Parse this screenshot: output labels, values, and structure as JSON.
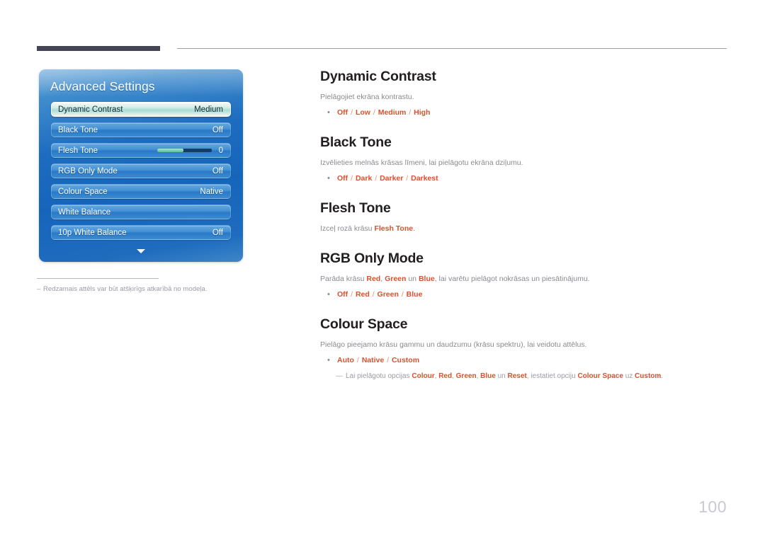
{
  "page": {
    "number": "100"
  },
  "osd": {
    "title": "Advanced Settings",
    "more_icon": "chevron-down-icon",
    "rows": [
      {
        "label": "Dynamic Contrast",
        "value": "Medium",
        "selected": true,
        "type": "value"
      },
      {
        "label": "Black Tone",
        "value": "Off",
        "selected": false,
        "type": "value"
      },
      {
        "label": "Flesh Tone",
        "value": "0",
        "selected": false,
        "type": "slider",
        "slider_percent": 48
      },
      {
        "label": "RGB Only Mode",
        "value": "Off",
        "selected": false,
        "type": "value"
      },
      {
        "label": "Colour Space",
        "value": "Native",
        "selected": false,
        "type": "value"
      },
      {
        "label": "White Balance",
        "value": "",
        "selected": false,
        "type": "value"
      },
      {
        "label": "10p White Balance",
        "value": "Off",
        "selected": false,
        "type": "value"
      }
    ]
  },
  "caption": {
    "dash": "–",
    "text": "Redzamais attēls var būt atšķirīgs atkarībā no modeļa."
  },
  "sections": [
    {
      "title": "Dynamic Contrast",
      "desc": "Pielāgojiet ekrāna kontrastu.",
      "bullet": "•",
      "options": [
        "Off",
        "Low",
        "Medium",
        "High"
      ]
    },
    {
      "title": "Black Tone",
      "desc": "Izvēlieties melnās krāsas līmeni, lai pielāgotu ekrāna dziļumu.",
      "bullet": "•",
      "options": [
        "Off",
        "Dark",
        "Darker",
        "Darkest"
      ]
    },
    {
      "title": "Flesh Tone",
      "desc_pre": "Izceļ rozā krāsu ",
      "desc_hl": "Flesh Tone",
      "desc_post": ".",
      "bullet": "",
      "options": []
    },
    {
      "title": "RGB Only Mode",
      "desc_parts": [
        {
          "t": "Parāda krāsu ",
          "hl": false
        },
        {
          "t": "Red",
          "hl": true
        },
        {
          "t": ", ",
          "hl": false
        },
        {
          "t": "Green",
          "hl": true
        },
        {
          "t": " un ",
          "hl": false
        },
        {
          "t": "Blue",
          "hl": true
        },
        {
          "t": ", lai varētu pielāgot nokrāsas un piesātinājumu.",
          "hl": false
        }
      ],
      "bullet": "•",
      "options": [
        "Off",
        "Red",
        "Green",
        "Blue"
      ]
    },
    {
      "title": "Colour Space",
      "desc": "Pielāgo pieejamo krāsu gammu un daudzumu (krāsu spektru), lai veidotu attēlus.",
      "bullet": "•",
      "options": [
        "Auto",
        "Native",
        "Custom"
      ],
      "note": {
        "dash": "—",
        "parts": [
          {
            "t": "Lai pielāgotu opcijas ",
            "hl": false
          },
          {
            "t": "Colour",
            "hl": true
          },
          {
            "t": ", ",
            "hl": false
          },
          {
            "t": "Red",
            "hl": true
          },
          {
            "t": ", ",
            "hl": false
          },
          {
            "t": "Green",
            "hl": true
          },
          {
            "t": ", ",
            "hl": false
          },
          {
            "t": "Blue",
            "hl": true
          },
          {
            "t": " un ",
            "hl": false
          },
          {
            "t": "Reset",
            "hl": true
          },
          {
            "t": ", iestatiet opciju ",
            "hl": false
          },
          {
            "t": "Colour Space",
            "hl": true
          },
          {
            "t": " uz ",
            "hl": false
          },
          {
            "t": "Custom",
            "hl": true
          },
          {
            "t": ".",
            "hl": false
          }
        ]
      }
    }
  ],
  "colors": {
    "accent_orange": "#d9512c",
    "heading_dark": "#231f20",
    "body_gray": "#8a8a90",
    "rule_dark": "#454357",
    "page_num_gray": "#c9c9d2",
    "osd_blue": "#1565bb"
  },
  "separator": "/"
}
